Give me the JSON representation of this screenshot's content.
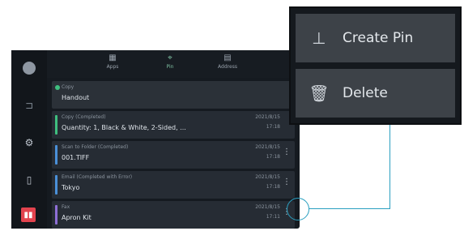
{
  "rail": {
    "icons": [
      "user-icon",
      "lock-icon",
      "settings-icon",
      "device-icon",
      "stop-icon"
    ]
  },
  "tabs": [
    {
      "label": "Apps",
      "icon": "apps-icon"
    },
    {
      "label": "Pin",
      "icon": "pin-icon"
    },
    {
      "label": "Address",
      "icon": "address-icon"
    }
  ],
  "jobs": [
    {
      "status": "Copy",
      "title": "Handout",
      "date": "",
      "time": "",
      "color": "#3fbf7f"
    },
    {
      "status": "Copy (Completed)",
      "title": "Quantity: 1, Black & White, 2-Sided, ...",
      "date": "2021/8/15",
      "time": "17:18",
      "color": "#3fbf7f"
    },
    {
      "status": "Scan to Folder (Completed)",
      "title": "001.TIFF",
      "date": "2021/8/15",
      "time": "17:18",
      "color": "#4a90d9"
    },
    {
      "status": "Email (Completed with Error)",
      "title": "Tokyo",
      "date": "2021/8/15",
      "time": "17:18",
      "color": "#4a90d9"
    },
    {
      "status": "Fax",
      "title": "Apron Kit",
      "date": "2021/8/15",
      "time": "17:11",
      "color": "#8e6fd6"
    }
  ],
  "menu": {
    "create_pin": "Create Pin",
    "delete": "Delete"
  },
  "colors": {
    "accent": "#2a9fc0",
    "stop": "#e2434e"
  }
}
